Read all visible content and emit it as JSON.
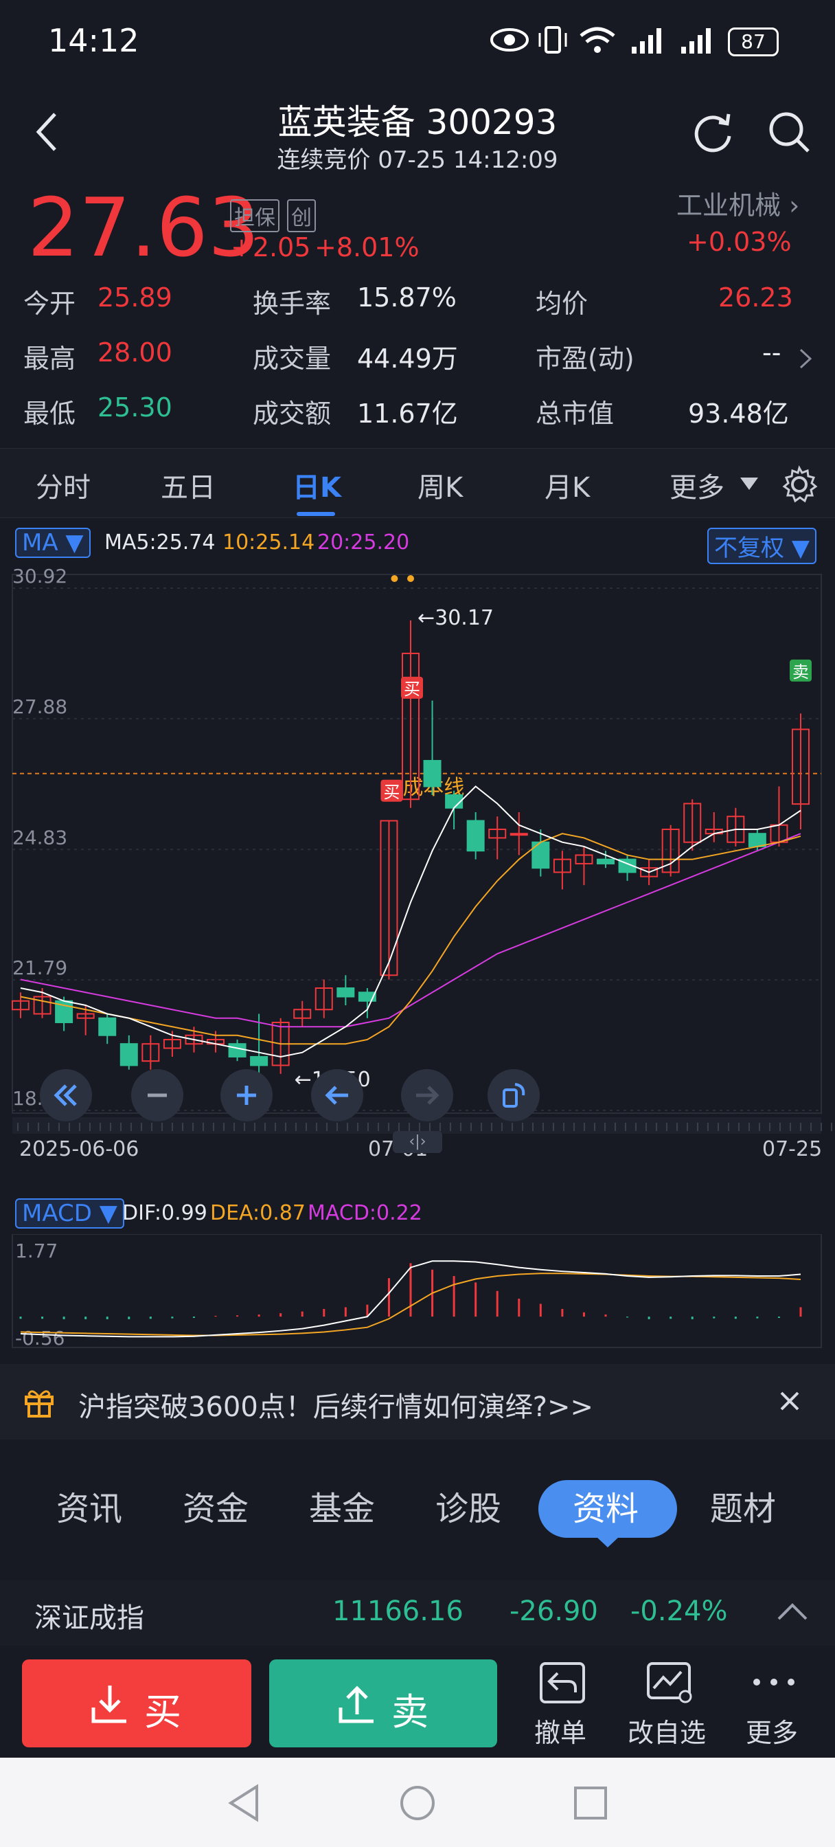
{
  "status_bar": {
    "time": "14:12",
    "battery": "87"
  },
  "header": {
    "title": "蓝英装备 300293",
    "subtitle": "连续竞价 07-25 14:12:09"
  },
  "quote": {
    "price": "27.63",
    "tag1": "担保",
    "tag2": "创",
    "change": "+2.05",
    "change_pct": "+8.01%",
    "sector": "工业机械",
    "sector_change": "+0.03%",
    "stats": [
      {
        "label": "今开",
        "value": "25.89"
      },
      {
        "label": "换手率",
        "value": "15.87%"
      },
      {
        "label": "均价",
        "value": "26.23"
      },
      {
        "label": "最高",
        "value": "28.00"
      },
      {
        "label": "成交量",
        "value": "44.49万"
      },
      {
        "label": "市盈(动)",
        "value": "--"
      },
      {
        "label": "最低",
        "value": "25.30"
      },
      {
        "label": "成交额",
        "value": "11.67亿"
      },
      {
        "label": "总市值",
        "value": "93.48亿"
      }
    ]
  },
  "ktabs": [
    "分时",
    "五日",
    "日K",
    "周K",
    "月K",
    "更多"
  ],
  "chart_controls": {
    "ma_selector": "MA",
    "ma5": "MA5:25.74",
    "ma10": "10:25.14",
    "ma20": "20:25.20",
    "adjust": "不复权",
    "cost_line": "成本线",
    "high_marker": "←30.17",
    "low_marker": "←19.50",
    "buy_signal": "买",
    "sell_signal": "卖"
  },
  "chart_data": {
    "type": "candlestick",
    "yticks": [
      "30.92",
      "27.88",
      "24.83",
      "21.79",
      "18.75"
    ],
    "ylim": [
      18.75,
      30.92
    ],
    "xticks": [
      "2025-06-06",
      "07-01",
      "07-25"
    ],
    "cost_line": 26.6,
    "candles": [
      {
        "o": 21.1,
        "c": 21.3,
        "h": 21.5,
        "l": 20.9
      },
      {
        "o": 21.0,
        "c": 21.4,
        "h": 21.6,
        "l": 20.9
      },
      {
        "o": 21.3,
        "c": 20.8,
        "h": 21.4,
        "l": 20.6
      },
      {
        "o": 20.9,
        "c": 21.0,
        "h": 21.2,
        "l": 20.5
      },
      {
        "o": 20.9,
        "c": 20.5,
        "h": 21.0,
        "l": 20.3
      },
      {
        "o": 20.3,
        "c": 19.8,
        "h": 20.5,
        "l": 19.7
      },
      {
        "o": 19.9,
        "c": 20.3,
        "h": 20.5,
        "l": 19.7
      },
      {
        "o": 20.2,
        "c": 20.4,
        "h": 20.6,
        "l": 20.0
      },
      {
        "o": 20.3,
        "c": 20.5,
        "h": 20.7,
        "l": 20.1
      },
      {
        "o": 20.3,
        "c": 20.4,
        "h": 20.6,
        "l": 20.1
      },
      {
        "o": 20.3,
        "c": 20.0,
        "h": 20.4,
        "l": 19.9
      },
      {
        "o": 20.0,
        "c": 19.8,
        "h": 21.0,
        "l": 19.5
      },
      {
        "o": 19.8,
        "c": 20.8,
        "h": 20.9,
        "l": 19.6
      },
      {
        "o": 20.9,
        "c": 21.1,
        "h": 21.3,
        "l": 20.7
      },
      {
        "o": 21.1,
        "c": 21.6,
        "h": 21.8,
        "l": 20.9
      },
      {
        "o": 21.6,
        "c": 21.4,
        "h": 21.9,
        "l": 21.2
      },
      {
        "o": 21.5,
        "c": 21.3,
        "h": 21.6,
        "l": 20.9
      },
      {
        "o": 21.9,
        "c": 25.5,
        "h": 25.5,
        "l": 21.8
      },
      {
        "o": 26.0,
        "c": 29.4,
        "h": 30.17,
        "l": 25.8
      },
      {
        "o": 26.9,
        "c": 26.3,
        "h": 28.3,
        "l": 26.1
      },
      {
        "o": 26.1,
        "c": 25.8,
        "h": 26.2,
        "l": 25.3
      },
      {
        "o": 25.5,
        "c": 24.8,
        "h": 25.7,
        "l": 24.6
      },
      {
        "o": 25.1,
        "c": 25.3,
        "h": 25.6,
        "l": 24.6
      },
      {
        "o": 25.2,
        "c": 25.2,
        "h": 25.7,
        "l": 24.7
      },
      {
        "o": 25.0,
        "c": 24.4,
        "h": 25.3,
        "l": 24.2
      },
      {
        "o": 24.3,
        "c": 24.6,
        "h": 24.8,
        "l": 23.9
      },
      {
        "o": 24.5,
        "c": 24.7,
        "h": 24.9,
        "l": 24.0
      },
      {
        "o": 24.6,
        "c": 24.5,
        "h": 24.8,
        "l": 24.4
      },
      {
        "o": 24.6,
        "c": 24.3,
        "h": 24.7,
        "l": 24.1
      },
      {
        "o": 24.2,
        "c": 24.4,
        "h": 24.6,
        "l": 24.0
      },
      {
        "o": 24.3,
        "c": 25.3,
        "h": 25.4,
        "l": 24.2
      },
      {
        "o": 25.0,
        "c": 25.9,
        "h": 26.0,
        "l": 24.8
      },
      {
        "o": 25.2,
        "c": 25.3,
        "h": 25.7,
        "l": 25.0
      },
      {
        "o": 25.0,
        "c": 25.6,
        "h": 25.8,
        "l": 24.9
      },
      {
        "o": 25.2,
        "c": 24.9,
        "h": 25.3,
        "l": 24.8
      },
      {
        "o": 25.0,
        "c": 25.4,
        "h": 26.3,
        "l": 24.9
      },
      {
        "o": 25.89,
        "c": 27.63,
        "h": 28.0,
        "l": 25.3
      }
    ],
    "ma5": [
      21.6,
      21.5,
      21.3,
      21.2,
      21.0,
      20.9,
      20.7,
      20.5,
      20.4,
      20.3,
      20.2,
      20.1,
      20.0,
      20.1,
      20.4,
      20.7,
      21.1,
      22.2,
      23.6,
      24.8,
      25.8,
      26.3,
      25.9,
      25.4,
      25.2,
      25.0,
      24.9,
      24.7,
      24.5,
      24.3,
      24.5,
      24.9,
      25.2,
      25.3,
      25.3,
      25.4,
      25.74
    ],
    "ma10": [
      21.4,
      21.3,
      21.2,
      21.1,
      21.0,
      20.9,
      20.8,
      20.7,
      20.6,
      20.5,
      20.5,
      20.4,
      20.3,
      20.3,
      20.3,
      20.3,
      20.4,
      20.7,
      21.3,
      22.0,
      22.8,
      23.5,
      24.1,
      24.6,
      25.0,
      25.2,
      25.1,
      24.9,
      24.7,
      24.6,
      24.6,
      24.6,
      24.7,
      24.8,
      24.9,
      25.0,
      25.14
    ],
    "ma20": [
      21.8,
      21.7,
      21.6,
      21.5,
      21.4,
      21.3,
      21.2,
      21.1,
      21.0,
      20.9,
      20.9,
      20.8,
      20.7,
      20.7,
      20.7,
      20.7,
      20.8,
      20.9,
      21.2,
      21.5,
      21.8,
      22.1,
      22.4,
      22.6,
      22.8,
      23.0,
      23.2,
      23.4,
      23.6,
      23.8,
      24.0,
      24.2,
      24.4,
      24.6,
      24.8,
      25.0,
      25.2
    ]
  },
  "macd": {
    "selector": "MACD",
    "dif": "DIF:0.99",
    "dea": "DEA:0.87",
    "macd": "MACD:0.22",
    "ytop": "1.77",
    "ybottom": "-0.56",
    "ylim": [
      -0.56,
      1.77
    ],
    "hist": [
      -0.05,
      -0.05,
      -0.06,
      -0.06,
      -0.06,
      -0.06,
      -0.05,
      -0.04,
      -0.03,
      0.02,
      0.03,
      0.05,
      0.08,
      0.12,
      0.18,
      0.22,
      0.28,
      0.9,
      1.25,
      1.1,
      0.95,
      0.8,
      0.6,
      0.42,
      0.3,
      0.18,
      0.1,
      0.05,
      -0.02,
      -0.06,
      -0.05,
      -0.06,
      -0.04,
      -0.05,
      -0.04,
      -0.03,
      0.22
    ],
    "dif_line": [
      -0.4,
      -0.42,
      -0.44,
      -0.45,
      -0.46,
      -0.47,
      -0.47,
      -0.47,
      -0.46,
      -0.43,
      -0.4,
      -0.37,
      -0.33,
      -0.28,
      -0.2,
      -0.1,
      0.0,
      0.55,
      1.15,
      1.3,
      1.3,
      1.28,
      1.22,
      1.15,
      1.1,
      1.06,
      1.03,
      1.0,
      0.95,
      0.92,
      0.93,
      0.95,
      0.96,
      0.96,
      0.95,
      0.95,
      0.99
    ],
    "dea_line": [
      -0.36,
      -0.37,
      -0.38,
      -0.39,
      -0.4,
      -0.41,
      -0.42,
      -0.43,
      -0.44,
      -0.44,
      -0.43,
      -0.42,
      -0.41,
      -0.39,
      -0.36,
      -0.31,
      -0.25,
      -0.05,
      0.25,
      0.55,
      0.75,
      0.88,
      0.95,
      0.99,
      1.01,
      1.01,
      1.0,
      0.99,
      0.97,
      0.95,
      0.94,
      0.94,
      0.93,
      0.92,
      0.91,
      0.9,
      0.87
    ]
  },
  "banner": {
    "text": "沪指突破3600点！后续行情如何演绎?>>"
  },
  "bottom_tabs": [
    "资讯",
    "资金",
    "基金",
    "诊股",
    "资料",
    "题材"
  ],
  "ticker": {
    "name": "深证成指",
    "value": "11166.16",
    "change": "-26.90",
    "pct": "-0.24%"
  },
  "actions": {
    "buy": "买",
    "sell": "卖",
    "cancel": "撤单",
    "edit_watch": "改自选",
    "more": "更多"
  },
  "colors": {
    "up": "#f0373b",
    "down": "#2dbf93",
    "ma5": "#ffffff",
    "ma10": "#f5a623",
    "ma20": "#d63be0",
    "accent": "#3b82f6"
  }
}
